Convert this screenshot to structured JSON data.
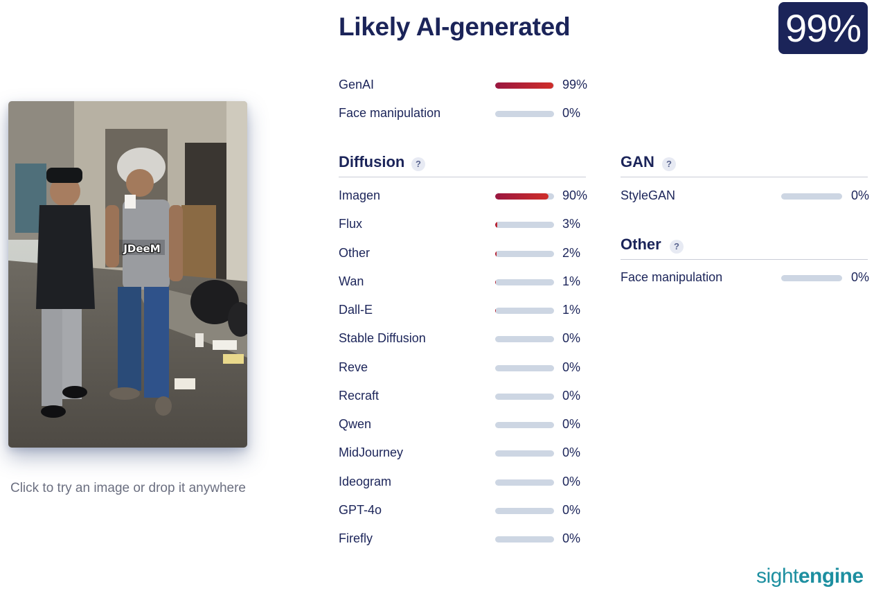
{
  "upload": {
    "hint": "Click to try an image or drop it anywhere",
    "watermark": "JDeeM"
  },
  "verdict": {
    "title": "Likely AI-generated",
    "score_label": "99%",
    "score": 0.99
  },
  "summary": [
    {
      "label": "GenAI",
      "value_label": "99%",
      "value": 0.99
    },
    {
      "label": "Face manipulation",
      "value_label": "0%",
      "value": 0
    }
  ],
  "diffusion": {
    "title": "Diffusion",
    "help": "?",
    "items": [
      {
        "label": "Imagen",
        "value_label": "90%",
        "value": 0.9
      },
      {
        "label": "Flux",
        "value_label": "3%",
        "value": 0.03
      },
      {
        "label": "Other",
        "value_label": "2%",
        "value": 0.02
      },
      {
        "label": "Wan",
        "value_label": "1%",
        "value": 0.01
      },
      {
        "label": "Dall-E",
        "value_label": "1%",
        "value": 0.01
      },
      {
        "label": "Stable Diffusion",
        "value_label": "0%",
        "value": 0
      },
      {
        "label": "Reve",
        "value_label": "0%",
        "value": 0
      },
      {
        "label": "Recraft",
        "value_label": "0%",
        "value": 0
      },
      {
        "label": "Qwen",
        "value_label": "0%",
        "value": 0
      },
      {
        "label": "MidJourney",
        "value_label": "0%",
        "value": 0
      },
      {
        "label": "Ideogram",
        "value_label": "0%",
        "value": 0
      },
      {
        "label": "GPT-4o",
        "value_label": "0%",
        "value": 0
      },
      {
        "label": "Firefly",
        "value_label": "0%",
        "value": 0
      }
    ]
  },
  "gan": {
    "title": "GAN",
    "help": "?",
    "items": [
      {
        "label": "StyleGAN",
        "value_label": "0%",
        "value": 0
      }
    ]
  },
  "other": {
    "title": "Other",
    "help": "?",
    "items": [
      {
        "label": "Face manipulation",
        "value_label": "0%",
        "value": 0
      }
    ]
  },
  "brand": {
    "part1": "sight",
    "part2": "engine"
  },
  "colors": {
    "navy": "#1b2459",
    "bar_track": "#cdd6e3",
    "bar_fill_start": "#9a1740",
    "bar_fill_end": "#cf2e2a",
    "brand": "#1d8fa0"
  }
}
